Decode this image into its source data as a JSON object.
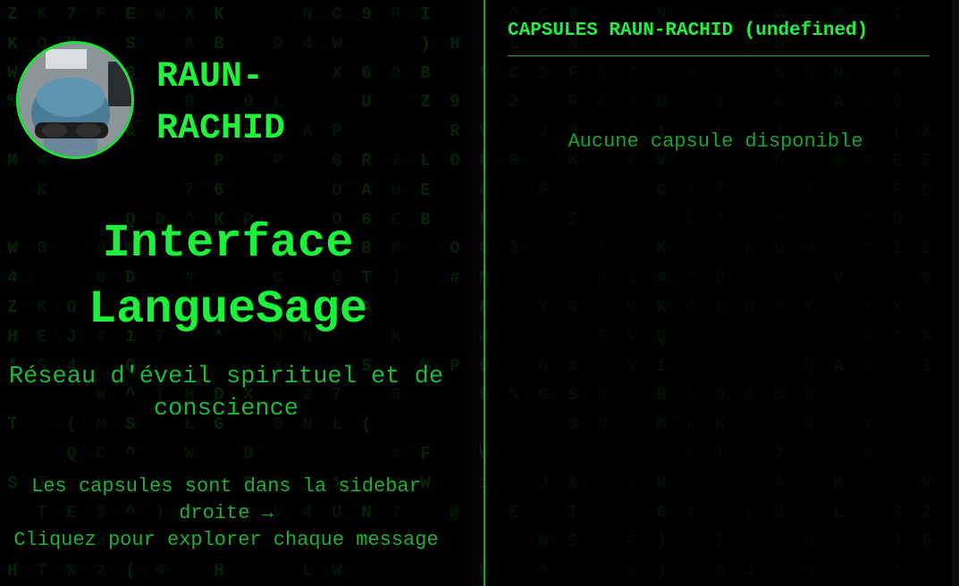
{
  "profile": {
    "name": "RAUN-\nRACHID",
    "avatar_alt": "Photo de profil"
  },
  "main": {
    "title": "Interface LangueSage",
    "subtitle": "Réseau d'éveil spirituel et de conscience",
    "hint_line1": "Les capsules sont dans la sidebar droite →",
    "hint_line2": "Cliquez pour explorer chaque message"
  },
  "sidebar": {
    "header": "CAPSULES RAUN-RACHID (undefined)",
    "empty_text": "Aucune capsule disponible"
  },
  "colors": {
    "accent": "#22f03c",
    "text_dim": "#1fb83a",
    "rain": "#0a6b14",
    "background": "#000000"
  }
}
